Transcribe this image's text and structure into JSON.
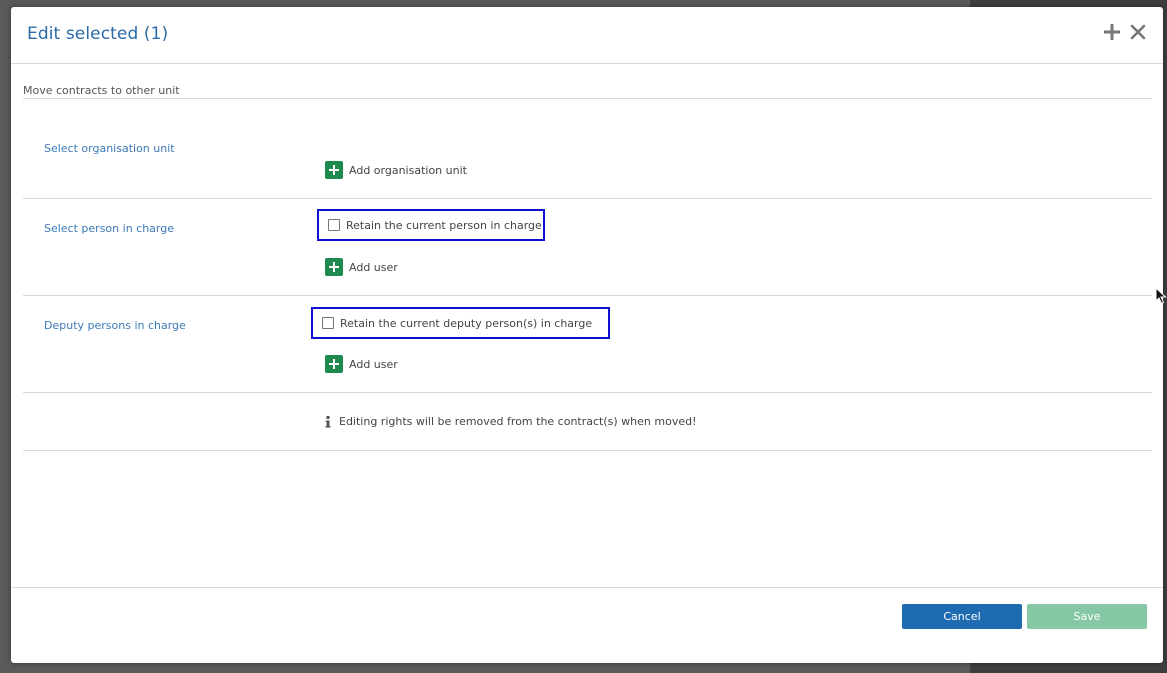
{
  "dialog": {
    "title": "Edit selected (1)",
    "section_label": "Move contracts to other unit"
  },
  "rows": {
    "org_unit": {
      "label": "Select organisation unit",
      "add_label": "Add organisation unit"
    },
    "person": {
      "label": "Select person in charge",
      "retain_label": "Retain the current person in charge",
      "add_label": "Add user"
    },
    "deputy": {
      "label": "Deputy persons in charge",
      "retain_label": "Retain the current deputy person(s) in charge",
      "add_label": "Add user"
    }
  },
  "info": {
    "text": "Editing rights will be removed from the contract(s) when moved!"
  },
  "footer": {
    "cancel_label": "Cancel",
    "save_label": "Save"
  },
  "colors": {
    "title": "#2a6aa8",
    "add_green": "#1e8a4f",
    "cancel_blue": "#1e6bb2",
    "save_green_disabled": "#86c7a6",
    "highlight_box": "#1010d0"
  }
}
